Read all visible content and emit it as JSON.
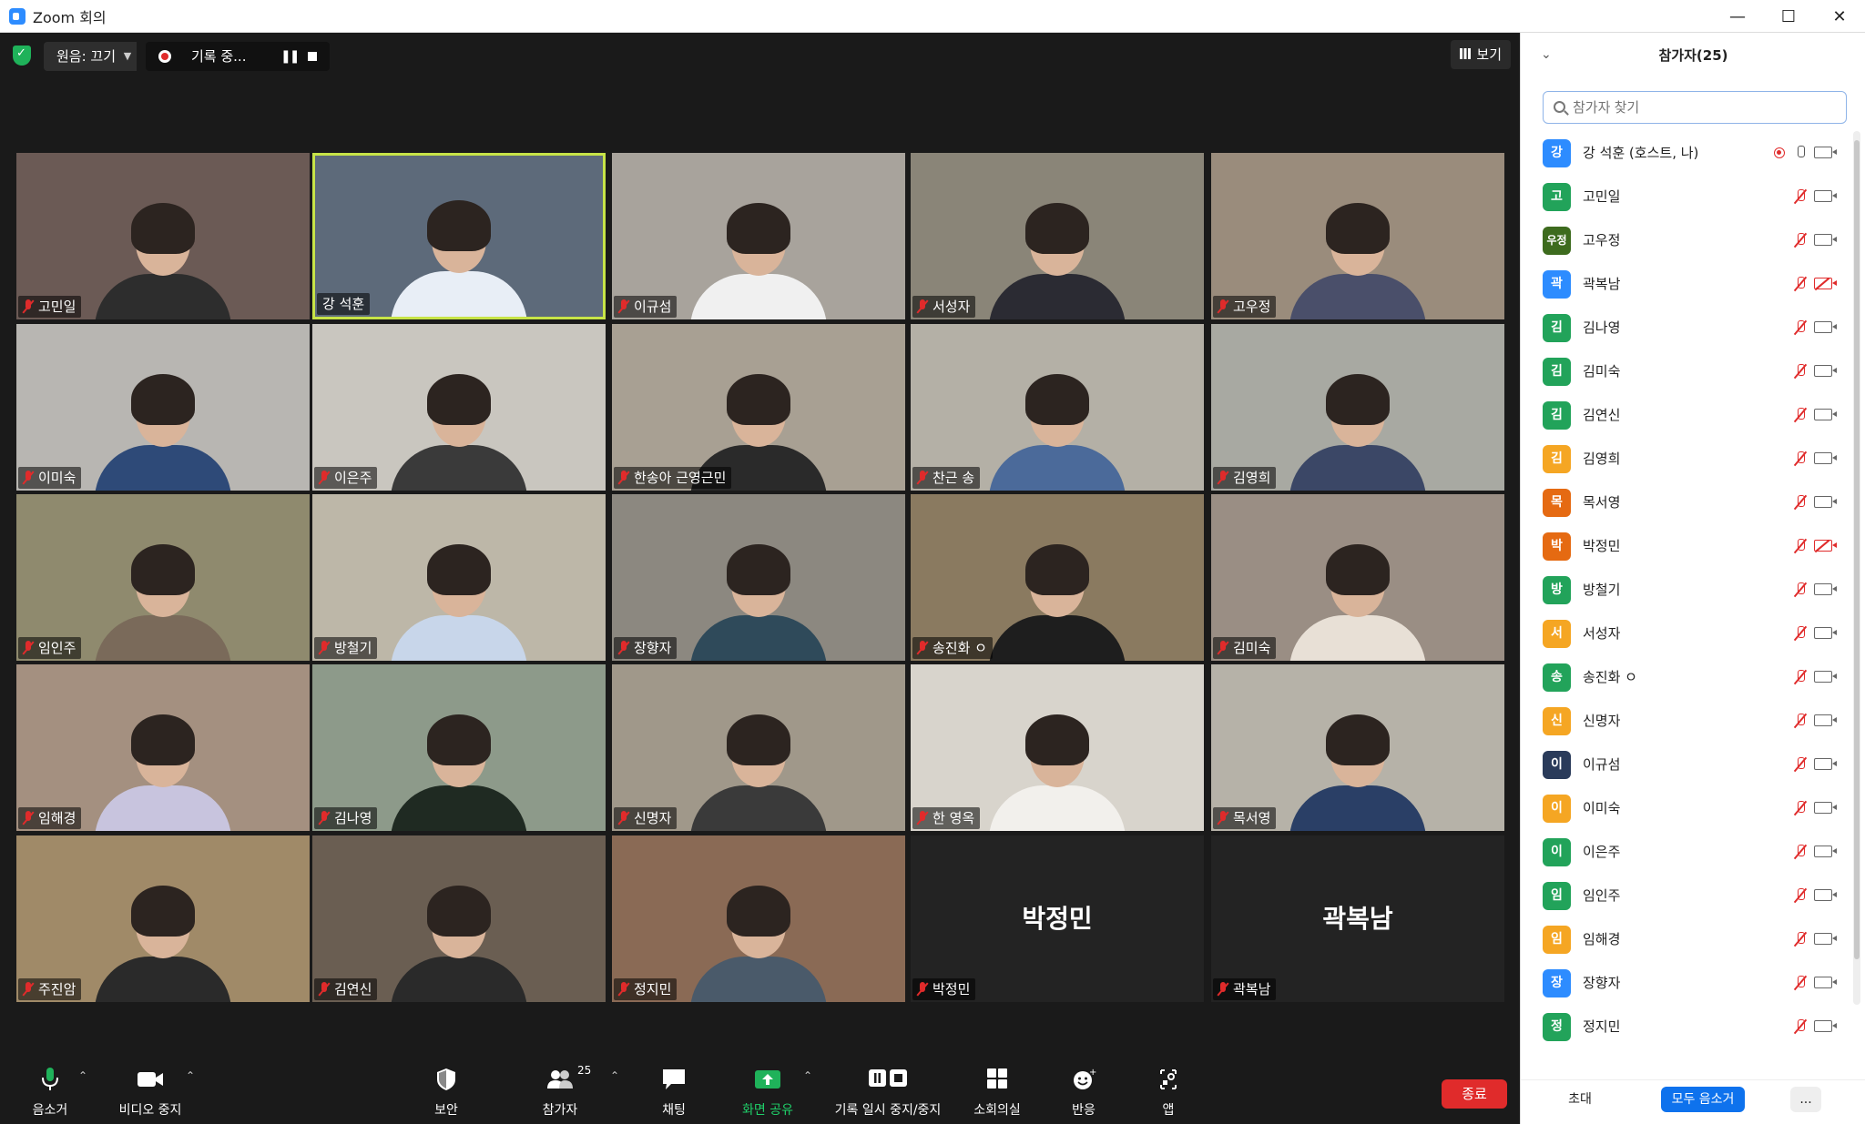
{
  "window": {
    "title": "Zoom 회의"
  },
  "topbar": {
    "original_sound": "원음: 끄기",
    "recording_label": "기록 중...",
    "view_label": "보기"
  },
  "tiles": [
    {
      "name": "고민일",
      "muted": true,
      "bg": "#6b5a55",
      "shirt": "#2d2d2d"
    },
    {
      "name": "강 석훈",
      "muted": false,
      "active": true,
      "bg": "#5d6a7a",
      "shirt": "#e8eef6"
    },
    {
      "name": "이규섬",
      "muted": true,
      "bg": "#a8a39c",
      "shirt": "#f0f0f0"
    },
    {
      "name": "서성자",
      "muted": true,
      "bg": "#8a8578",
      "shirt": "#2b2b33"
    },
    {
      "name": "고우정",
      "muted": true,
      "bg": "#9a8c7c",
      "shirt": "#4a4f6a"
    },
    {
      "name": "이미숙",
      "muted": true,
      "bg": "#b8b6b2",
      "shirt": "#2e4a78"
    },
    {
      "name": "이은주",
      "muted": true,
      "bg": "#c9c6bf",
      "shirt": "#3a3a3a"
    },
    {
      "name": "한송아 근영근민",
      "muted": true,
      "bg": "#a8a093",
      "shirt": "#2a2a2a"
    },
    {
      "name": "찬근 송",
      "muted": true,
      "bg": "#b4b0a6",
      "shirt": "#4b6a9a"
    },
    {
      "name": "김영희",
      "muted": true,
      "bg": "#a8a9a2",
      "shirt": "#3b4766"
    },
    {
      "name": "임인주",
      "muted": true,
      "bg": "#8f8a6e",
      "shirt": "#7a6a5a"
    },
    {
      "name": "방철기",
      "muted": true,
      "bg": "#bdb7a8",
      "shirt": "#c8d6ea"
    },
    {
      "name": "장향자",
      "muted": true,
      "bg": "#8c8880",
      "shirt": "#2f4a5a"
    },
    {
      "name": "송진화 ㅇ",
      "muted": true,
      "bg": "#8a7a60",
      "shirt": "#1e1e1e"
    },
    {
      "name": "김미숙",
      "muted": true,
      "bg": "#9a8e84",
      "shirt": "#e8e0d6"
    },
    {
      "name": "임해경",
      "muted": true,
      "bg": "#a49080",
      "shirt": "#c8c4de"
    },
    {
      "name": "김나영",
      "muted": true,
      "bg": "#8d9a8a",
      "shirt": "#1f2a22"
    },
    {
      "name": "신명자",
      "muted": true,
      "bg": "#a0988a",
      "shirt": "#3a3a3a"
    },
    {
      "name": "한 영옥",
      "muted": true,
      "bg": "#d8d4cc",
      "shirt": "#f2f0ec"
    },
    {
      "name": "목서영",
      "muted": true,
      "bg": "#b6b2a8",
      "shirt": "#2a3f66"
    },
    {
      "name": "주진암",
      "muted": true,
      "bg": "#a08a68",
      "shirt": "#2a2a2a"
    },
    {
      "name": "김연신",
      "muted": true,
      "bg": "#6a5e52",
      "shirt": "#2a2a2a"
    },
    {
      "name": "정지민",
      "muted": true,
      "bg": "#8a6a55",
      "shirt": "#4a5a6a"
    },
    {
      "name": "박정민",
      "muted": true,
      "video_off": true
    },
    {
      "name": "곽복남",
      "muted": true,
      "video_off": true
    }
  ],
  "toolbar": {
    "audio": "음소거",
    "video": "비디오 중지",
    "security": "보안",
    "participants": "참가자",
    "participants_count": "25",
    "chat": "채팅",
    "share": "화면 공유",
    "record": "기록 일시 중지/중지",
    "breakout": "소회의실",
    "reactions": "반응",
    "apps": "앱",
    "end": "종료"
  },
  "panel": {
    "title": "참가자(25)",
    "search_placeholder": "참가자 찾기",
    "invite": "초대",
    "mute_all": "모두 음소거",
    "more": "...",
    "participants": [
      {
        "avatar": "강",
        "name": "강 석훈 (호스트, 나)",
        "color": "#2d8cff",
        "mic": "live",
        "cam": "on",
        "rec": true
      },
      {
        "avatar": "고",
        "name": "고민일",
        "color": "#22a35a",
        "mic": "muted",
        "cam": "on"
      },
      {
        "avatar": "우정",
        "name": "고우정",
        "color": "#3d6b1e",
        "mic": "muted",
        "cam": "on"
      },
      {
        "avatar": "곽",
        "name": "곽복남",
        "color": "#2d8cff",
        "mic": "muted",
        "cam": "off"
      },
      {
        "avatar": "김",
        "name": "김나영",
        "color": "#22a35a",
        "mic": "muted",
        "cam": "on"
      },
      {
        "avatar": "김",
        "name": "김미숙",
        "color": "#22a35a",
        "mic": "muted",
        "cam": "on"
      },
      {
        "avatar": "김",
        "name": "김연신",
        "color": "#22a35a",
        "mic": "muted",
        "cam": "on"
      },
      {
        "avatar": "김",
        "name": "김영희",
        "color": "#f5a623",
        "mic": "muted",
        "cam": "on"
      },
      {
        "avatar": "목",
        "name": "목서영",
        "color": "#e56a12",
        "mic": "muted",
        "cam": "on"
      },
      {
        "avatar": "박",
        "name": "박정민",
        "color": "#e56a12",
        "mic": "muted",
        "cam": "off"
      },
      {
        "avatar": "방",
        "name": "방철기",
        "color": "#22a35a",
        "mic": "muted",
        "cam": "on"
      },
      {
        "avatar": "서",
        "name": "서성자",
        "color": "#f5a623",
        "mic": "muted",
        "cam": "on"
      },
      {
        "avatar": "송",
        "name": "송진화 ㅇ",
        "color": "#22a35a",
        "mic": "muted",
        "cam": "on"
      },
      {
        "avatar": "신",
        "name": "신명자",
        "color": "#f5a623",
        "mic": "muted",
        "cam": "on"
      },
      {
        "avatar": "이",
        "name": "이규섬",
        "color": "#2a3b5a",
        "mic": "muted",
        "cam": "on"
      },
      {
        "avatar": "이",
        "name": "이미숙",
        "color": "#f5a623",
        "mic": "muted",
        "cam": "on"
      },
      {
        "avatar": "이",
        "name": "이은주",
        "color": "#22a35a",
        "mic": "muted",
        "cam": "on"
      },
      {
        "avatar": "임",
        "name": "임인주",
        "color": "#22a35a",
        "mic": "muted",
        "cam": "on"
      },
      {
        "avatar": "임",
        "name": "임해경",
        "color": "#f5a623",
        "mic": "muted",
        "cam": "on"
      },
      {
        "avatar": "장",
        "name": "장향자",
        "color": "#2d8cff",
        "mic": "muted",
        "cam": "on"
      },
      {
        "avatar": "정",
        "name": "정지민",
        "color": "#22a35a",
        "mic": "muted",
        "cam": "on"
      }
    ]
  }
}
